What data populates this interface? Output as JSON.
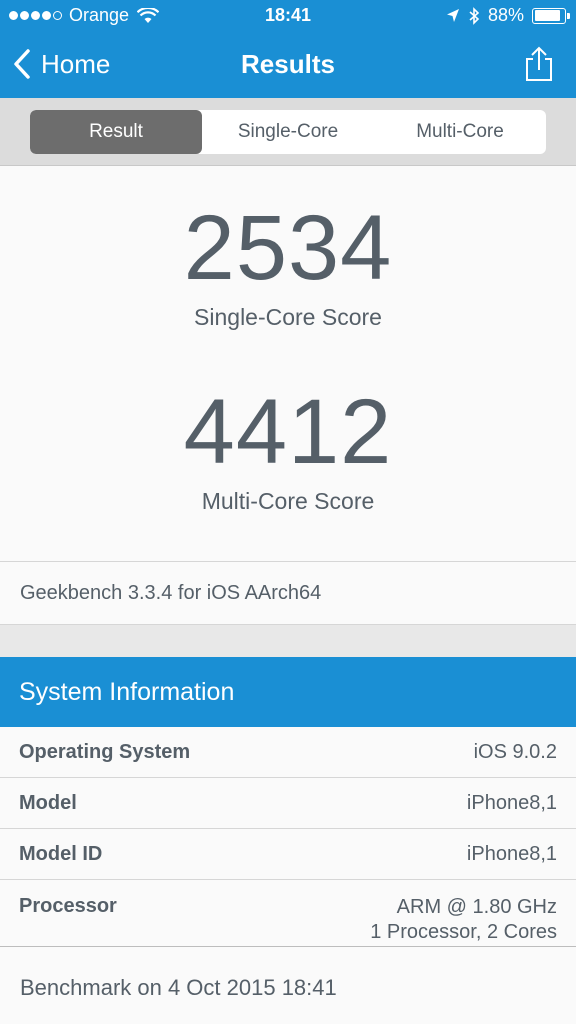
{
  "status_bar": {
    "carrier": "Orange",
    "time": "18:41",
    "battery": "88%",
    "battery_level": 0.88,
    "signal_bars_filled": 4,
    "signal_bars_total": 5,
    "icons": [
      "wifi-icon",
      "location-arrow-icon",
      "bluetooth-icon",
      "battery-icon"
    ]
  },
  "nav": {
    "back_label": "Home",
    "title": "Results",
    "share_icon": "share-icon"
  },
  "tabs": [
    "Result",
    "Single-Core",
    "Multi-Core"
  ],
  "scores": {
    "single_value": "2534",
    "single_label": "Single-Core Score",
    "multi_value": "4412",
    "multi_label": "Multi-Core Score"
  },
  "version": "Geekbench 3.3.4 for iOS AArch64",
  "system_info": {
    "title": "System Information",
    "rows": [
      {
        "key": "Operating System",
        "value": "iOS 9.0.2"
      },
      {
        "key": "Model",
        "value": "iPhone8,1"
      },
      {
        "key": "Model ID",
        "value": "iPhone8,1"
      },
      {
        "key": "Processor",
        "value": "ARM @ 1.80 GHz",
        "value2": "1 Processor, 2 Cores"
      }
    ]
  },
  "footer": "Benchmark on 4 Oct 2015 18:41",
  "colors": {
    "accent": "#1a8fd4",
    "text": "#555f68",
    "active_segment": "#6d6d6d"
  }
}
